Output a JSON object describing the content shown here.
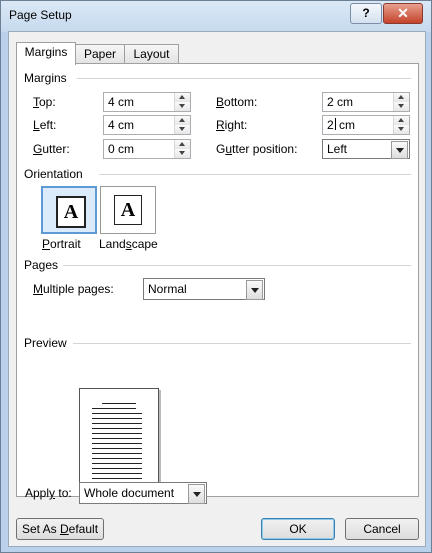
{
  "window": {
    "title": "Page Setup",
    "help_label": "?",
    "close_label": "✕"
  },
  "tabs": [
    {
      "label": "Margins",
      "active": true
    },
    {
      "label": "Paper",
      "active": false
    },
    {
      "label": "Layout",
      "active": false
    }
  ],
  "margins": {
    "section_label": "Margins",
    "top": {
      "label_u": "T",
      "label_rest": "op:",
      "value": "4 cm"
    },
    "left": {
      "label_u": "L",
      "label_rest": "eft:",
      "value": "4 cm"
    },
    "gutter": {
      "label_u": "G",
      "label_pre": "",
      "label_rest": "utter:",
      "value": "0 cm"
    },
    "bottom": {
      "label_u": "B",
      "label_rest": "ottom:",
      "value": "2 cm"
    },
    "right": {
      "label_u": "R",
      "label_rest": "ight:",
      "value_pre": "2",
      "value_post": " cm"
    },
    "gutter_position": {
      "label_pre": "G",
      "label_u": "u",
      "label_rest": "tter position:",
      "value": "Left"
    }
  },
  "orientation": {
    "section_label": "Orientation",
    "portrait": {
      "glyph": "A",
      "label_u": "P",
      "label_rest": "ortrait",
      "selected": true
    },
    "landscape": {
      "glyph": "A",
      "label_pre": "Land",
      "label_u": "s",
      "label_rest": "cape",
      "selected": false
    }
  },
  "pages": {
    "section_label": "Pages",
    "multiple_label_u": "M",
    "multiple_label_rest": "ultiple pages:",
    "multiple_value": "Normal"
  },
  "preview": {
    "section_label": "Preview"
  },
  "apply_to": {
    "label_pre": "Appl",
    "label_u": "y",
    "label_rest": " to:",
    "value": "Whole document"
  },
  "buttons": {
    "default_pre": "Set As ",
    "default_u": "D",
    "default_rest": "efault",
    "ok": "OK",
    "cancel": "Cancel"
  }
}
